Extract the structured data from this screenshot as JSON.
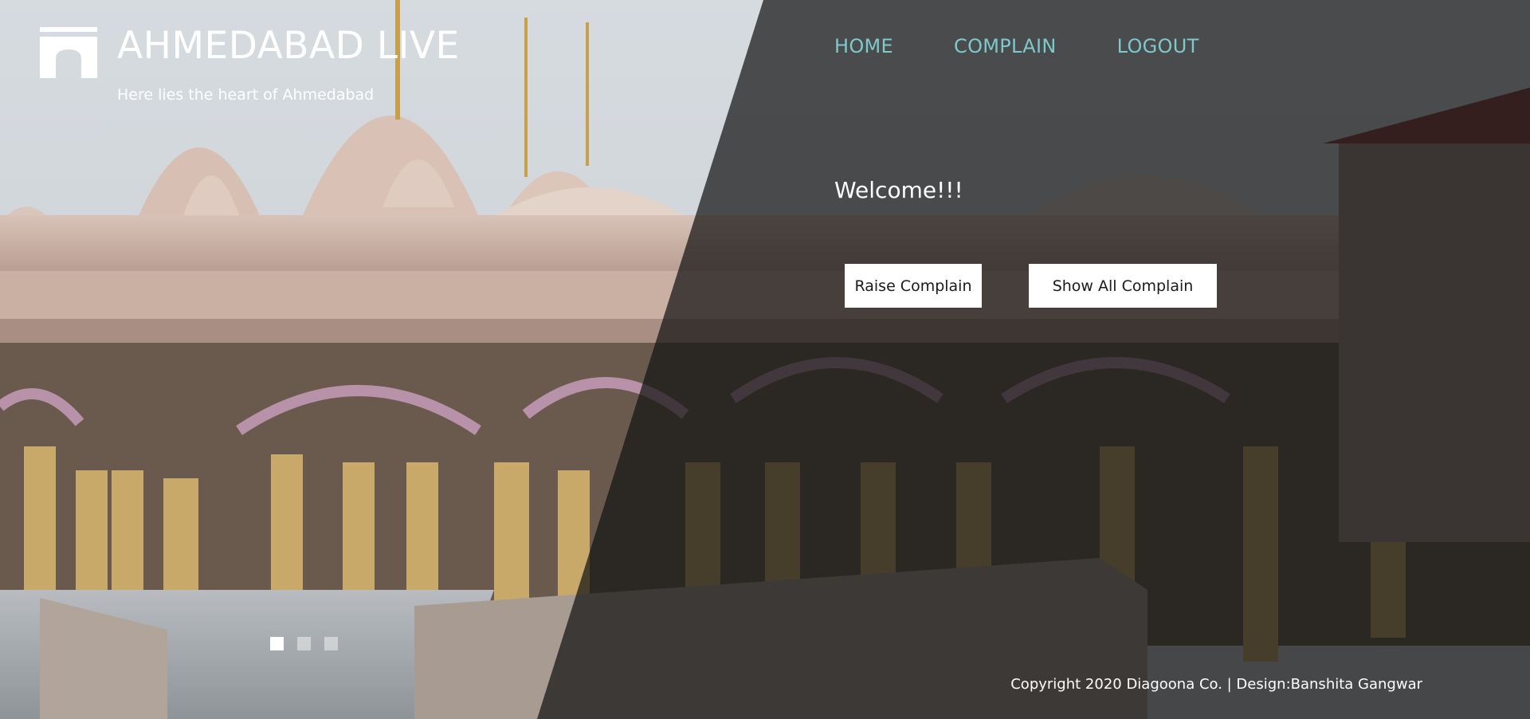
{
  "brand": {
    "title": "AHMEDABAD LIVE",
    "tagline": "Here lies the heart of Ahmedabad",
    "logo_icon": "arch-gate-icon"
  },
  "nav": {
    "items": [
      {
        "label": "HOME"
      },
      {
        "label": "COMPLAIN"
      },
      {
        "label": "LOGOUT"
      }
    ]
  },
  "main": {
    "welcome": "Welcome!!!",
    "raise_button": "Raise Complain",
    "show_button": "Show All Complain"
  },
  "slider": {
    "count": 3,
    "active_index": 0
  },
  "footer": {
    "copyright": "Copyright 2020 Diagoona Co. | Design:Banshita Gangwar"
  },
  "colors": {
    "nav_link": "#7ec9cb",
    "overlay": "#141414",
    "button_bg": "#ffffff"
  }
}
